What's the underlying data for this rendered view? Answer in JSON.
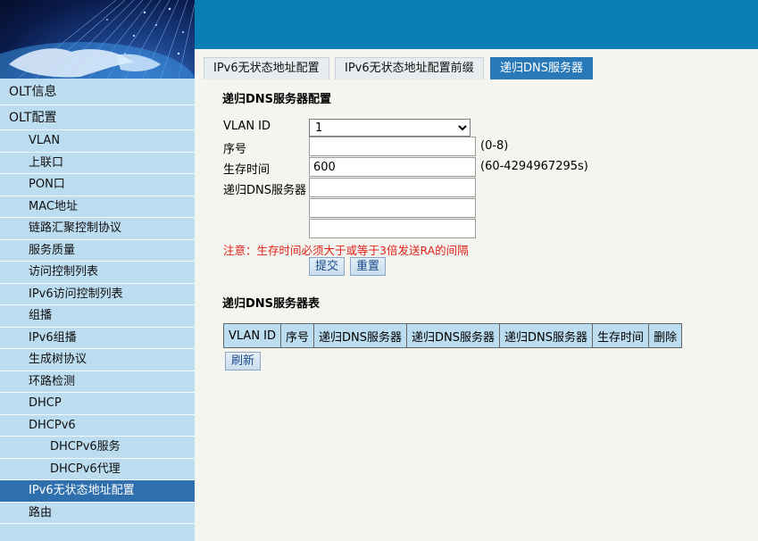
{
  "sidebar": {
    "items": [
      {
        "label": "OLT信息",
        "level": 0
      },
      {
        "label": "OLT配置",
        "level": 0
      },
      {
        "label": "VLAN",
        "level": 1
      },
      {
        "label": "上联口",
        "level": 1
      },
      {
        "label": "PON口",
        "level": 1
      },
      {
        "label": "MAC地址",
        "level": 1
      },
      {
        "label": "链路汇聚控制协议",
        "level": 1
      },
      {
        "label": "服务质量",
        "level": 1
      },
      {
        "label": "访问控制列表",
        "level": 1
      },
      {
        "label": "IPv6访问控制列表",
        "level": 1
      },
      {
        "label": "组播",
        "level": 1
      },
      {
        "label": "IPv6组播",
        "level": 1
      },
      {
        "label": "生成树协议",
        "level": 1
      },
      {
        "label": "环路检测",
        "level": 1
      },
      {
        "label": "DHCP",
        "level": 1
      },
      {
        "label": "DHCPv6",
        "level": 1
      },
      {
        "label": "DHCPv6服务",
        "level": 2
      },
      {
        "label": "DHCPv6代理",
        "level": 2
      },
      {
        "label": "IPv6无状态地址配置",
        "level": 1,
        "active": true
      },
      {
        "label": "路由",
        "level": 1
      }
    ]
  },
  "tabs": [
    {
      "label": "IPv6无状态地址配置"
    },
    {
      "label": "IPv6无状态地址配置前缀"
    },
    {
      "label": "递归DNS服务器",
      "active": true
    }
  ],
  "form": {
    "title": "递归DNS服务器配置",
    "vlan_label": "VLAN ID",
    "vlan_value": "1",
    "index_label": "序号",
    "index_value": "",
    "index_hint": "(0-8)",
    "lifetime_label": "生存时间",
    "lifetime_value": "600",
    "lifetime_hint": "(60-4294967295s)",
    "dns_label": "递归DNS服务器",
    "dns_values": [
      "",
      "",
      ""
    ],
    "note": "注意：生存时间必须大于或等于3倍发送RA的间隔",
    "submit_label": "提交",
    "reset_label": "重置"
  },
  "table": {
    "title": "递归DNS服务器表",
    "columns": [
      "VLAN ID",
      "序号",
      "递归DNS服务器",
      "递归DNS服务器",
      "递归DNS服务器",
      "生存时间",
      "删除"
    ],
    "refresh_label": "刷新"
  },
  "colors": {
    "header_blue": "#0a7fb6",
    "active_tab": "#2979b8",
    "active_menu": "#2f6fad",
    "sidebar_bg": "#bcdcef",
    "note_red": "#e0201a"
  }
}
